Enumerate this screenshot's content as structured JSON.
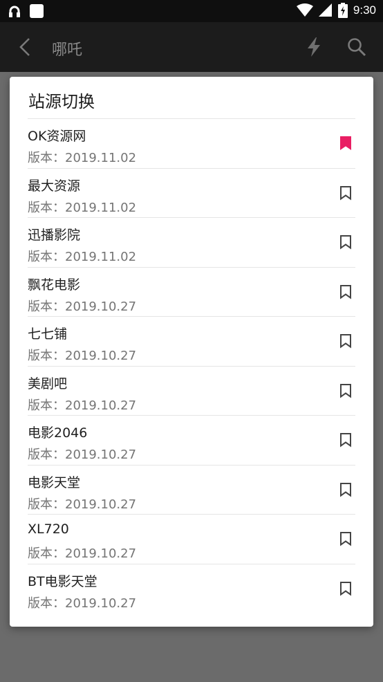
{
  "status_bar": {
    "time": "9:30",
    "left_icons": [
      "headphones-icon",
      "notification-square-icon"
    ],
    "right_icons": [
      "wifi-icon",
      "cellular-signal-icon",
      "battery-charging-icon"
    ]
  },
  "app_bar": {
    "title": "哪吒",
    "icons": [
      "back-arrow-icon",
      "flash-icon",
      "search-icon"
    ]
  },
  "dialog": {
    "title": "站源切换",
    "selected_color": "#e91e63",
    "items": [
      {
        "name": "OK资源网",
        "version": "版本：2019.11.02",
        "selected": true
      },
      {
        "name": "最大资源",
        "version": "版本：2019.11.02",
        "selected": false
      },
      {
        "name": "迅播影院",
        "version": "版本：2019.11.02",
        "selected": false
      },
      {
        "name": "飘花电影",
        "version": "版本：2019.10.27",
        "selected": false
      },
      {
        "name": "七七铺",
        "version": "版本：2019.10.27",
        "selected": false
      },
      {
        "name": "美剧吧",
        "version": "版本：2019.10.27",
        "selected": false
      },
      {
        "name": "电影2046",
        "version": "版本：2019.10.27",
        "selected": false
      },
      {
        "name": "电影天堂",
        "version": "版本：2019.10.27",
        "selected": false
      },
      {
        "name": "XL720",
        "version": "版本：2019.10.27",
        "selected": false
      },
      {
        "name": "BT电影天堂",
        "version": "版本：2019.10.27",
        "selected": false
      }
    ]
  }
}
